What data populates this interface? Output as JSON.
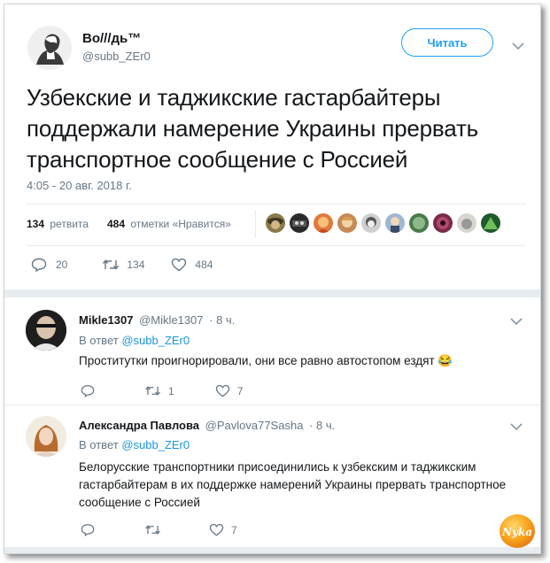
{
  "main_tweet": {
    "display_name": "Во///дь™",
    "handle": "@subb_ZEr0",
    "follow_label": "Читать",
    "text": "Узбекские и таджикские гастарбайтеры поддержали намерение Украины прервать транспортное сообщение с Россией",
    "timestamp": "4:05 - 20 авг. 2018 г.",
    "retweets_count": "134",
    "retweets_label": "ретвита",
    "likes_count": "484",
    "likes_label": "отметки «Нравится»",
    "actions": {
      "replies": "20",
      "retweets": "134",
      "likes": "484"
    }
  },
  "replies": [
    {
      "display_name": "Mikle1307",
      "handle": "@Mikle1307",
      "time": "· 8 ч.",
      "reply_to_prefix": "В ответ",
      "reply_to_handle": "@subb_ZEr0",
      "text": "Проститутки проигнорировали, они все равно автостопом ездят",
      "emoji": "😂",
      "actions": {
        "replies": "",
        "retweets": "1",
        "likes": "7"
      }
    },
    {
      "display_name": "Александра Павлова",
      "handle": "@Pavlova77Sasha",
      "time": "· 8 ч.",
      "reply_to_prefix": "В ответ",
      "reply_to_handle": "@subb_ZEr0",
      "text": "Белорусские транспортники присоединились к узбекским и таджикским гастарбайтерам в их поддержке намерений Украины прервать транспортное сообщение с Россией",
      "actions": {
        "replies": "",
        "retweets": "",
        "likes": "7"
      }
    }
  ],
  "colors": {
    "accent": "#1da1f2",
    "muted": "#657786",
    "link": "#1b95e0"
  },
  "watermark": "Nyka"
}
